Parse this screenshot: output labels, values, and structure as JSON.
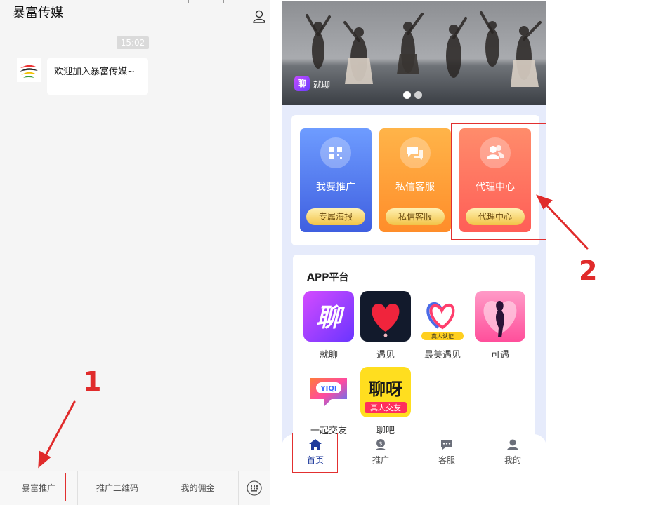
{
  "chat": {
    "title": "暴富传媒",
    "time": "15:02",
    "message": "欢迎加入暴富传媒~",
    "menu": [
      "暴富推广",
      "推广二维码",
      "我的佣金"
    ]
  },
  "app": {
    "brand": "就聊",
    "banner_dots": 2,
    "tiles": [
      {
        "label": "我要推广",
        "button": "专属海报",
        "color_top": "#6e9cff",
        "color_bottom": "#3f5fe0",
        "icon": "qr-code-icon"
      },
      {
        "label": "私信客服",
        "button": "私信客服",
        "color_top": "#ffb449",
        "color_bottom": "#ff8d2a",
        "icon": "chat-bubbles-icon"
      },
      {
        "label": "代理中心",
        "button": "代理中心",
        "color_top": "#ff8c6b",
        "color_bottom": "#ff5e57",
        "icon": "users-icon"
      }
    ],
    "platform_title": "APP平台",
    "apps": [
      {
        "name": "就聊",
        "icon": "jiuliao-logo"
      },
      {
        "name": "遇见",
        "icon": "yujian-heart-logo"
      },
      {
        "name": "最美遇见",
        "icon": "zuimei-heart-logo",
        "badge": "真人认证"
      },
      {
        "name": "可遇",
        "icon": "keyu-logo"
      },
      {
        "name": "一起交友",
        "icon": "yiqi-logo",
        "badge": "YIQI"
      },
      {
        "name": "聊吧",
        "icon": "liaoba-logo",
        "text": "聊呀",
        "badge": "真人交友"
      }
    ],
    "tabs": [
      {
        "label": "首页",
        "icon": "home-icon"
      },
      {
        "label": "推广",
        "icon": "promote-icon"
      },
      {
        "label": "客服",
        "icon": "message-icon"
      },
      {
        "label": "我的",
        "icon": "profile-icon"
      }
    ],
    "active_tab": "首页",
    "jiuliao_glyph": "聊"
  },
  "annotations": {
    "step1": "1",
    "step2": "2",
    "color": "#e02b2b"
  }
}
